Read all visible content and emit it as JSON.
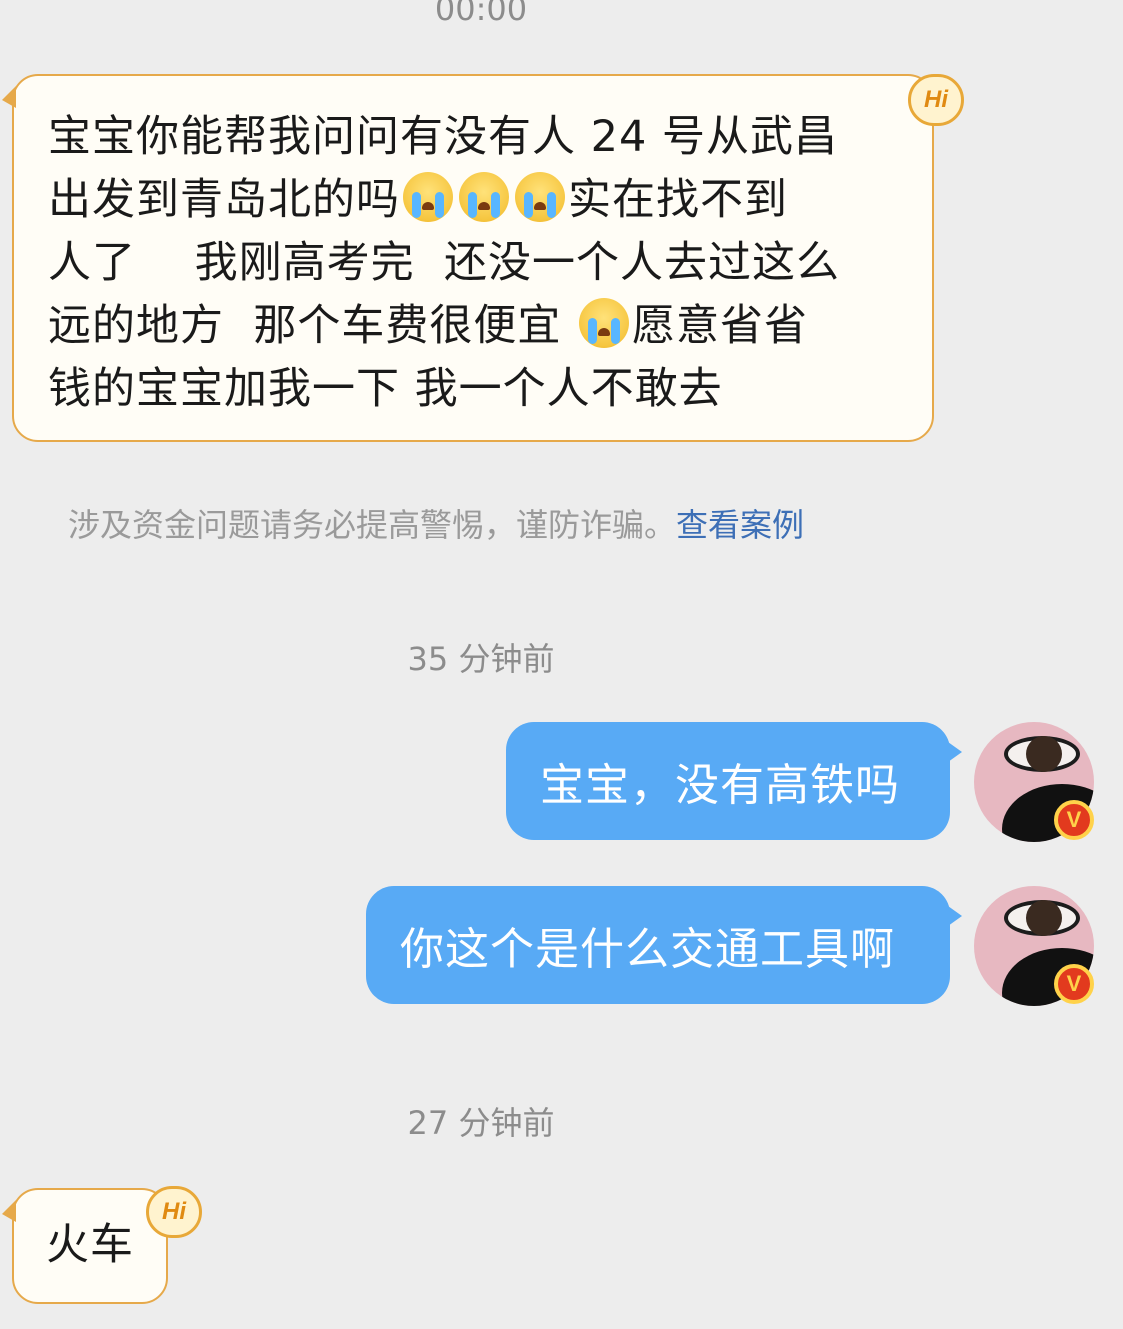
{
  "top_time": "00:00",
  "message1": {
    "line1": "宝宝你能帮我问问有没有人 24 号从武昌",
    "line2_a": "出发到青岛北的吗",
    "line2_b": "实在找不到",
    "line3": "人了　 我刚高考完  还没一个人去过这么",
    "line4_a": "远的地方  那个车费很便宜 ",
    "line4_b": "愿意省省",
    "line5": "钱的宝宝加我一下  我一个人不敢去"
  },
  "hi_badge": "Hi",
  "notice": {
    "text": "涉及资金问题请务必提高警惕，谨防诈骗。",
    "link": "查看案例"
  },
  "time2": "35 分钟前",
  "out1": "宝宝，没有高铁吗",
  "out2": "你这个是什么交通工具啊",
  "time3": "27 分钟前",
  "message2": "火车",
  "verified_badge": "V",
  "icons": [
    "crying-emoji-icon",
    "hi-badge-icon",
    "verified-v-icon"
  ],
  "colors": {
    "background": "#ededed",
    "incoming_border": "#e6a94a",
    "incoming_bg": "#fffdf6",
    "outgoing_bg": "#58aaf5",
    "link": "#3d6fb6",
    "muted": "#9a9a9a"
  }
}
